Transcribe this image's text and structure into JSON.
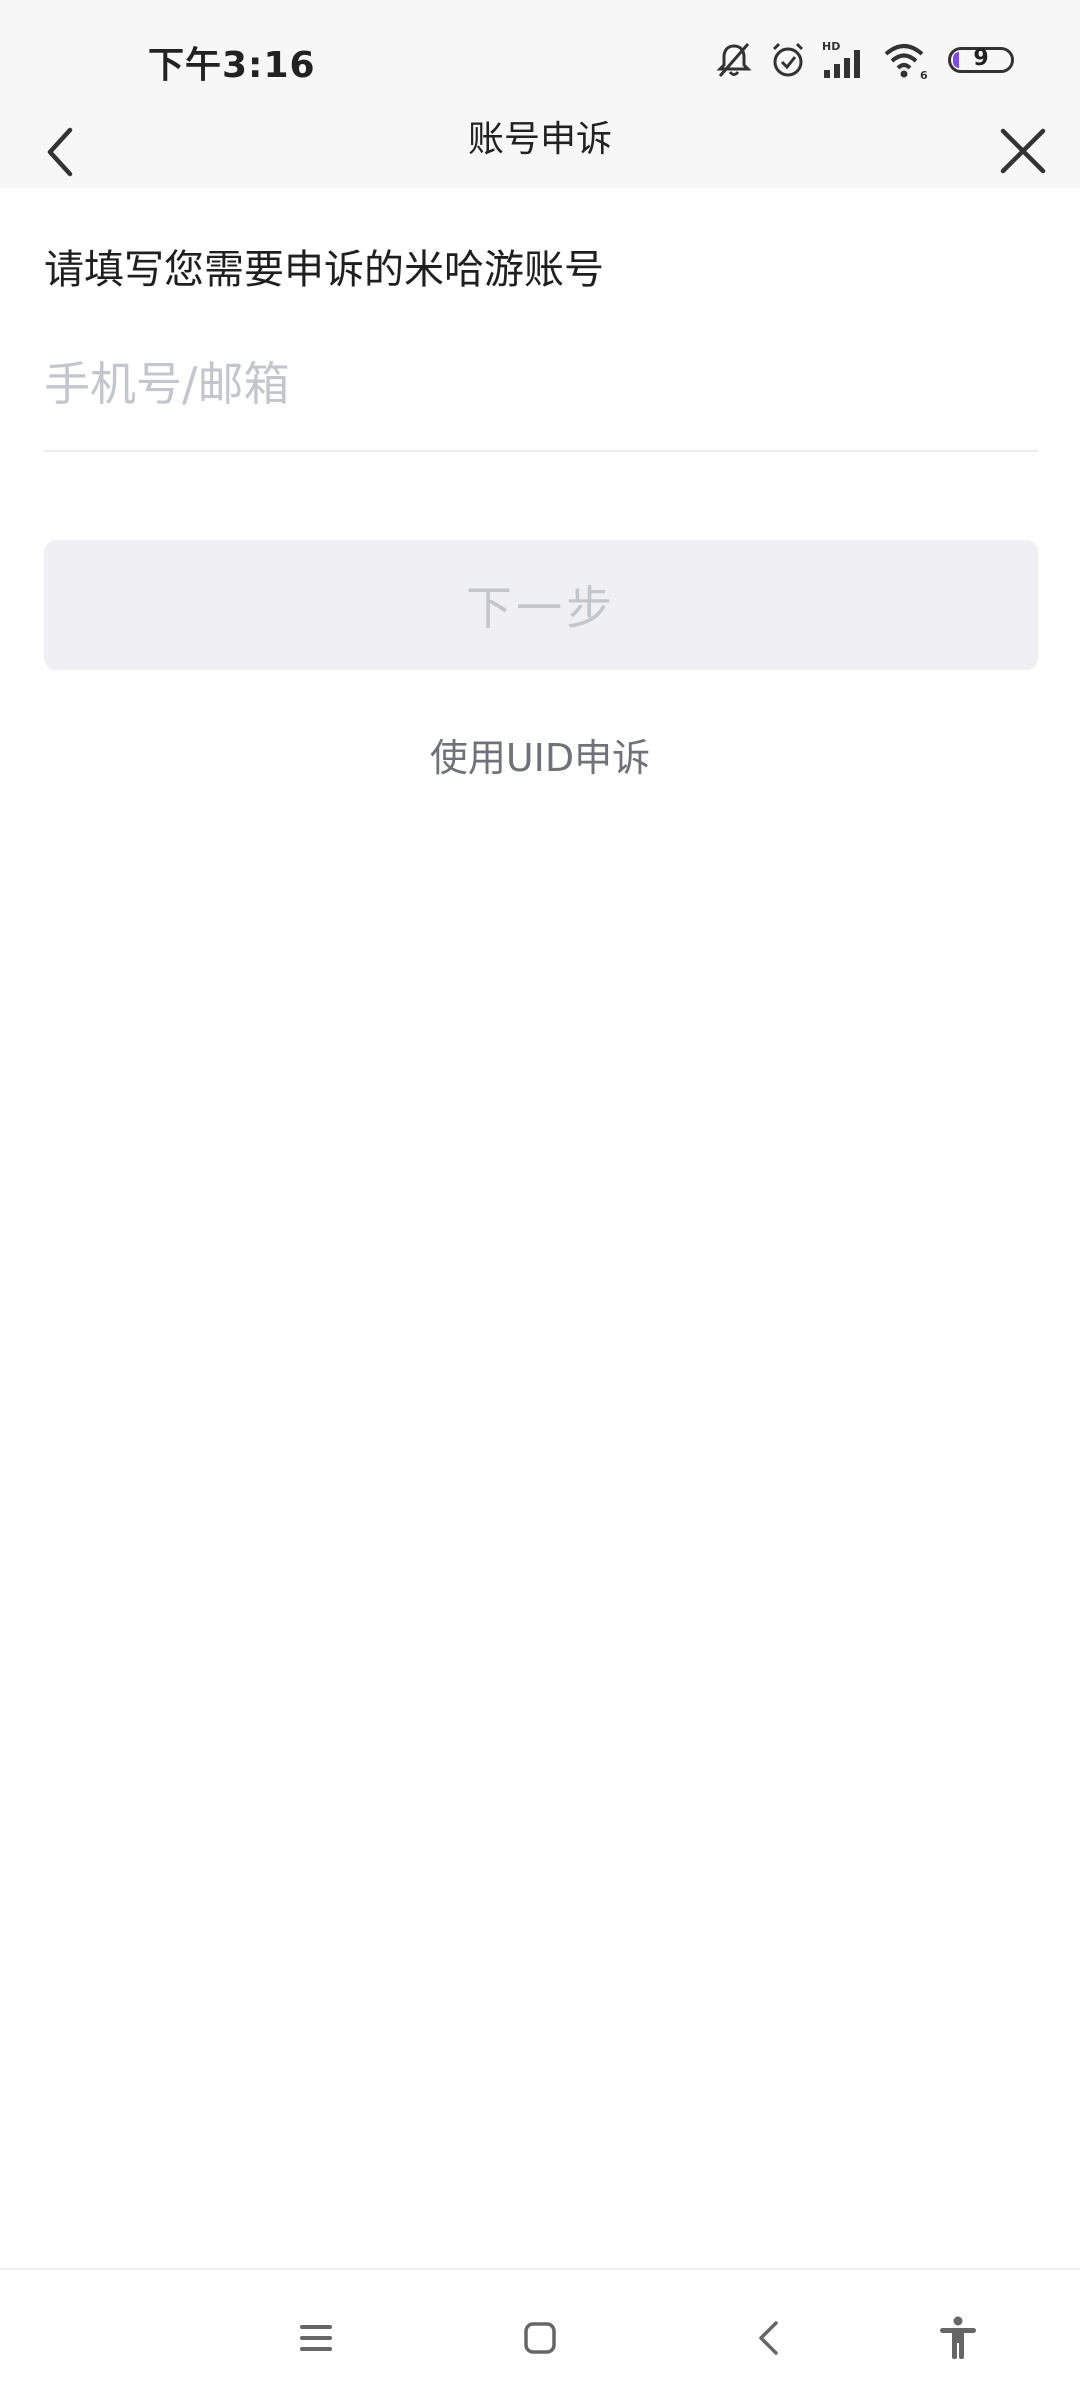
{
  "status_bar": {
    "time": "下午3:16",
    "icons": [
      "mute-icon",
      "alarm-icon",
      "hd-signal-icon",
      "wifi-icon",
      "battery-icon"
    ],
    "hd_label": "HD",
    "wifi_label": "6",
    "battery_level": "9"
  },
  "nav": {
    "title": "账号申诉",
    "back_icon": "chevron-left-icon",
    "close_icon": "close-icon"
  },
  "form": {
    "prompt": "请填写您需要申诉的米哈游账号",
    "input_value": "",
    "input_placeholder": "手机号/邮箱",
    "next_label": "下一步",
    "uid_link": "使用UID申诉"
  },
  "system_nav": {
    "buttons": [
      "menu-icon",
      "home-icon",
      "back-icon",
      "accessibility-icon"
    ]
  },
  "colors": {
    "header_bg": "#f7f7f7",
    "button_bg": "#f0f0f4",
    "placeholder": "#c3c6cc",
    "link": "#6f7278",
    "battery_accent": "#7b4be3"
  }
}
